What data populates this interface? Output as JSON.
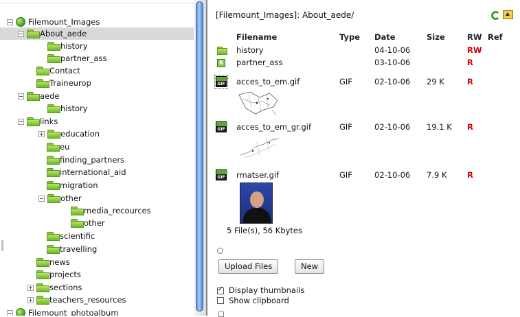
{
  "tree": {
    "items": [
      {
        "label": "Filemount_Images",
        "icon": "globe-icon",
        "toggle": "minus",
        "indent": 0
      },
      {
        "label": "About_aede",
        "icon": "folder-icon",
        "toggle": "minus",
        "indent": 1,
        "selected": true
      },
      {
        "label": "history",
        "icon": "folder-icon",
        "toggle": "none",
        "indent": 2
      },
      {
        "label": "partner_ass",
        "icon": "folder-icon",
        "toggle": "none",
        "indent": 2
      },
      {
        "label": "Contact",
        "icon": "folder-icon",
        "toggle": "none",
        "indent": 1
      },
      {
        "label": "Traineurop",
        "icon": "folder-icon",
        "toggle": "none",
        "indent": 1
      },
      {
        "label": "aede",
        "icon": "folder-icon",
        "toggle": "minus",
        "indent": 1
      },
      {
        "label": "history",
        "icon": "folder-icon",
        "toggle": "none",
        "indent": 2
      },
      {
        "label": "links",
        "icon": "folder-icon",
        "toggle": "minus",
        "indent": 1
      },
      {
        "label": "education",
        "icon": "folder-icon",
        "toggle": "plus",
        "indent": 2
      },
      {
        "label": "eu",
        "icon": "folder-icon",
        "toggle": "none",
        "indent": 2
      },
      {
        "label": "finding_partners",
        "icon": "folder-icon",
        "toggle": "none",
        "indent": 2
      },
      {
        "label": "international_aid",
        "icon": "folder-icon",
        "toggle": "none",
        "indent": 2
      },
      {
        "label": "migration",
        "icon": "folder-icon",
        "toggle": "none",
        "indent": 2
      },
      {
        "label": "other",
        "icon": "folder-icon",
        "toggle": "minus",
        "indent": 2
      },
      {
        "label": "media_recources",
        "icon": "folder-icon",
        "toggle": "none",
        "indent": 3
      },
      {
        "label": "other",
        "icon": "folder-icon",
        "toggle": "none",
        "indent": 3
      },
      {
        "label": "scientific",
        "icon": "folder-icon",
        "toggle": "none",
        "indent": 2
      },
      {
        "label": "travelling",
        "icon": "folder-icon",
        "toggle": "none",
        "indent": 2
      },
      {
        "label": "news",
        "icon": "folder-icon",
        "toggle": "none",
        "indent": 1
      },
      {
        "label": "projects",
        "icon": "folder-icon",
        "toggle": "none",
        "indent": 1
      },
      {
        "label": "sections",
        "icon": "folder-icon",
        "toggle": "plus",
        "indent": 1
      },
      {
        "label": "teachers_resources",
        "icon": "folder-icon",
        "toggle": "plus",
        "indent": 1
      },
      {
        "label": "Filemount_photoalbum",
        "icon": "globe-icon",
        "toggle": "minus",
        "indent": 0
      }
    ]
  },
  "filelist": {
    "path": "[Filemount_Images]: About_aede/",
    "headers": {
      "filename": "Filename",
      "type": "Type",
      "date": "Date",
      "size": "Size",
      "rw": "RW",
      "ref": "Ref"
    },
    "rows": [
      {
        "icon": "folder-icon",
        "name": "history",
        "type": "",
        "date": "04-10-06",
        "size": "",
        "rw": "RW"
      },
      {
        "icon": "readonly-folder-icon",
        "name": "partner_ass",
        "type": "",
        "date": "03-10-06",
        "size": "",
        "rw": "R"
      },
      {
        "icon": "gif-file-icon",
        "name": "acces_to_em.gif",
        "type": "GIF",
        "date": "02-10-06",
        "size": "29 K",
        "rw": "R"
      },
      {
        "icon": "gif-file-icon",
        "name": "acces_to_em_gr.gif",
        "type": "GIF",
        "date": "02-10-06",
        "size": "19.1 K",
        "rw": "R"
      },
      {
        "icon": "gif-file-icon",
        "name": "rmatser.gif",
        "type": "GIF",
        "date": "02-10-06",
        "size": "7.9 K",
        "rw": "R"
      }
    ],
    "summary": "5 File(s), 56 Kbytes"
  },
  "buttons": {
    "upload": "Upload Files",
    "new": "New"
  },
  "options": {
    "display_thumbnails": {
      "label": "Display thumbnails",
      "checked": true
    },
    "show_clipboard": {
      "label": "Show clipboard",
      "checked": false
    }
  },
  "icons": {
    "r_badge": "R",
    "gif_badge": "GIF"
  },
  "colors": {
    "folder_green": "#8fcc3c",
    "rw_red": "#cc0000",
    "scroll_blue": "#5b8fd8",
    "selection": "#d9d9d9"
  }
}
